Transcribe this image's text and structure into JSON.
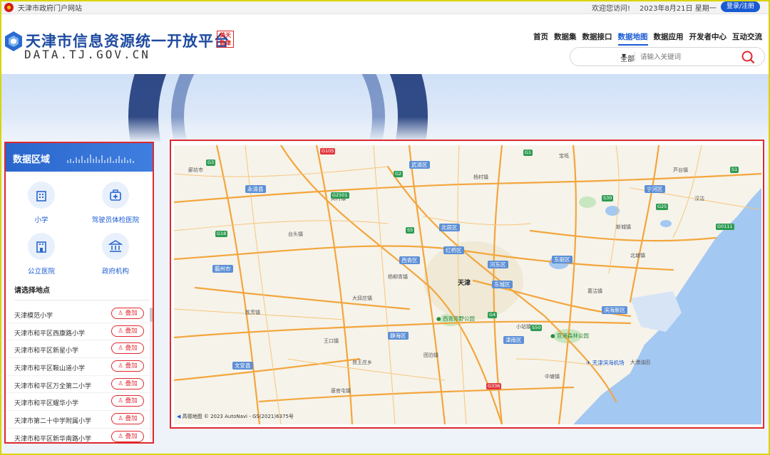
{
  "topbar": {
    "portal_label": "天津市政府门户网站",
    "welcome": "欢迎您访问!",
    "date": "2023年8月21日  星期一",
    "login": "登录/注册"
  },
  "header": {
    "title": "天津市信息资源统一开放平台",
    "domain": "DATA.TJ.GOV.CN",
    "seal_text": "美天数津",
    "nav": [
      {
        "label": "首页",
        "active": false
      },
      {
        "label": "数据集",
        "active": false
      },
      {
        "label": "数据接口",
        "active": false
      },
      {
        "label": "数据地图",
        "active": true
      },
      {
        "label": "数据应用",
        "active": false
      },
      {
        "label": "开发者中心",
        "active": false
      },
      {
        "label": "互动交流",
        "active": false
      }
    ],
    "search": {
      "category": "全部",
      "placeholder": "请输入关键词"
    }
  },
  "panel": {
    "title": "数据区域",
    "categories": [
      {
        "label": "小学",
        "icon": "school-building-icon"
      },
      {
        "label": "驾驶员体检医院",
        "icon": "medical-kit-icon"
      },
      {
        "label": "公立医院",
        "icon": "hospital-icon"
      },
      {
        "label": "政府机构",
        "icon": "government-building-icon"
      }
    ],
    "choose_label": "请选择地点",
    "add_label": "叠加",
    "locations": [
      "天津模范小学",
      "天津市和平区西康路小学",
      "天津市和平区新星小学",
      "天津市和平区鞍山道小学",
      "天津市和平区万全第二小学",
      "天津市和平区耀华小学",
      "天津市第二十中学附属小学",
      "天津市和平区新华南路小学"
    ]
  },
  "map": {
    "city": "天津",
    "districts": [
      "武清区",
      "北辰区",
      "红桥区",
      "河东区",
      "东丽区",
      "西青区",
      "津南区",
      "滨海新区",
      "宁河区",
      "静海区",
      "东城区",
      "永清县",
      "霸州市",
      "文安县"
    ],
    "places": [
      "杨村镇",
      "廊坊市",
      "高村镇",
      "胜芳镇",
      "大港油田",
      "宝坻",
      "芦台镇",
      "汉沽",
      "大邱庄镇",
      "杨柳青镇",
      "良王庄乡",
      "中塘镇",
      "小站镇",
      "葛沽镇",
      "北塘镇",
      "新城镇",
      "团泊镇",
      "王口镇",
      "唐官屯镇",
      "台头镇"
    ],
    "pois": [
      "西青郊野公园",
      "官港森林公园",
      "天津滨海机场"
    ],
    "highways": [
      "G3",
      "G2",
      "G1",
      "G18",
      "G25",
      "G0111",
      "G2501",
      "G4",
      "S1",
      "S30",
      "S50",
      "S5"
    ],
    "red_highways": [
      "G105",
      "G336"
    ],
    "copyright": "高德地图  © 2023 AutoNavi - GS(2021)6375号"
  }
}
